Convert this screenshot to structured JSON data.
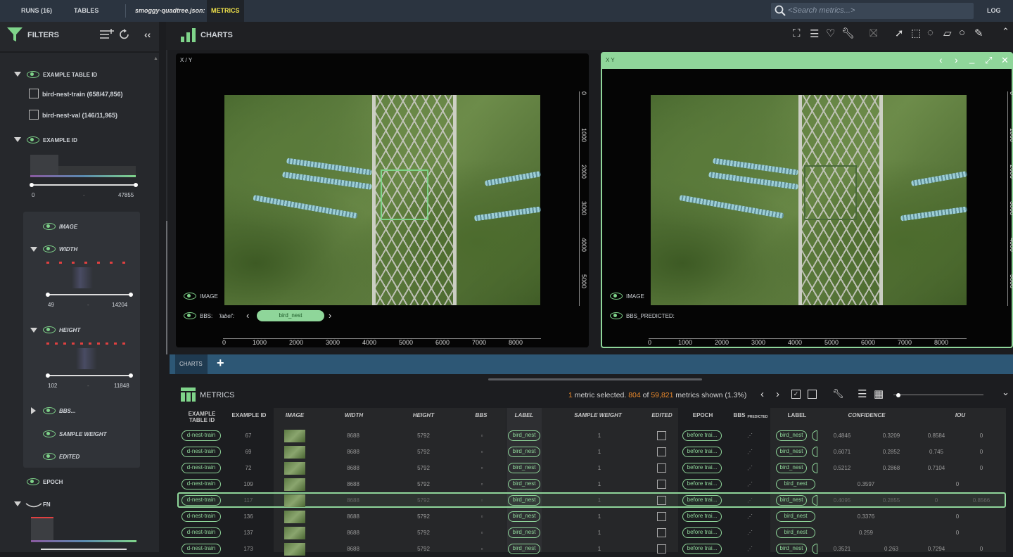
{
  "topbar": {
    "runs": "RUNS (16)",
    "tables": "TABLES",
    "file": "smoggy-quadtree.json:",
    "metrics": "METRICS",
    "search_placeholder": "<Search metrics...>",
    "log": "LOG"
  },
  "filters": {
    "title": "FILTERS",
    "example_table_id": "EXAMPLE TABLE ID",
    "table_items": [
      "bird-nest-train (658/47,856)",
      "bird-nest-val (146/11,965)"
    ],
    "example_id": "EXAMPLE ID",
    "example_id_min": "0",
    "example_id_sep": "-",
    "example_id_max": "47855",
    "image": "IMAGE",
    "width": "WIDTH",
    "width_min": "49",
    "width_max": "14204",
    "height": "HEIGHT",
    "height_min": "102",
    "height_max": "11848",
    "bbs": "BBS...",
    "sample_weight": "SAMPLE WEIGHT",
    "edited": "EDITED",
    "epoch": "EPOCH",
    "fn": "FN"
  },
  "charts": {
    "title": "CHARTS",
    "panel1": {
      "header": "X / Y",
      "image_label": "IMAGE",
      "bbs_label": "BBS:",
      "bbs_key": "'label':",
      "bbs_value": "bird_nest"
    },
    "panel2": {
      "header": "X   Y",
      "image_label": "IMAGE",
      "bbs_label": "BBS_PREDICTED:"
    },
    "xticks": [
      "0",
      "1000",
      "2000",
      "3000",
      "4000",
      "5000",
      "6000",
      "7000",
      "8000"
    ],
    "yticks": [
      "0",
      "1000",
      "2000",
      "3000",
      "4000",
      "5000"
    ]
  },
  "tabs": {
    "charts": "CHARTS",
    "add": "+"
  },
  "metrics": {
    "title": "METRICS",
    "selected_count": "1",
    "selected_text": " metric selected. ",
    "shown_count": "804",
    "of_text": " of ",
    "total": "59,821",
    "shown_text": " metrics shown (1.3%)"
  },
  "columns": [
    "EXAMPLE TABLE ID",
    "EXAMPLE ID",
    "IMAGE",
    "WIDTH",
    "HEIGHT",
    "BBS",
    "LABEL",
    "SAMPLE WEIGHT",
    "EDITED",
    "EPOCH",
    "BBS",
    "PREDICTED",
    "LABEL",
    "CONFIDENCE",
    "IOU"
  ],
  "rows": [
    {
      "table": "d-nest-train",
      "id": "67",
      "width": "8688",
      "height": "5792",
      "label": "bird_nest",
      "weight": "1",
      "epoch": "before trai...",
      "plabel": "bird_nest",
      "c1": "0.4846",
      "c2": "0.3209",
      "c3": "0.8584",
      "iou": "0"
    },
    {
      "table": "d-nest-train",
      "id": "69",
      "width": "8688",
      "height": "5792",
      "label": "bird_nest",
      "weight": "1",
      "epoch": "before trai...",
      "plabel": "bird_nest",
      "c1": "0.6071",
      "c2": "0.2852",
      "c3": "0.745",
      "iou": "0"
    },
    {
      "table": "d-nest-train",
      "id": "72",
      "width": "8688",
      "height": "5792",
      "label": "bird_nest",
      "weight": "1",
      "epoch": "before trai...",
      "plabel": "bird_nest",
      "c1": "0.5212",
      "c2": "0.2868",
      "c3": "0.7104",
      "iou": "0"
    },
    {
      "table": "d-nest-train",
      "id": "109",
      "width": "8688",
      "height": "5792",
      "label": "bird_nest",
      "weight": "1",
      "epoch": "before trai...",
      "plabel": "bird_nest",
      "c1": "",
      "c2": "0.3597",
      "c3": "",
      "iou": "0"
    },
    {
      "table": "d-nest-train",
      "id": "117",
      "width": "8688",
      "height": "5792",
      "label": "bird_nest",
      "weight": "1",
      "epoch": "before trai...",
      "plabel": "bird_nest",
      "c1": "0.4095",
      "c2": "0.2855",
      "c3": "0",
      "iou": "0.8566"
    },
    {
      "table": "d-nest-train",
      "id": "136",
      "width": "8688",
      "height": "5792",
      "label": "bird_nest",
      "weight": "1",
      "epoch": "before trai...",
      "plabel": "bird_nest",
      "c1": "",
      "c2": "0.3376",
      "c3": "",
      "iou": "0"
    },
    {
      "table": "d-nest-train",
      "id": "137",
      "width": "8688",
      "height": "5792",
      "label": "bird_nest",
      "weight": "1",
      "epoch": "before trai...",
      "plabel": "bird_nest",
      "c1": "",
      "c2": "0.259",
      "c3": "",
      "iou": "0"
    },
    {
      "table": "d-nest-train",
      "id": "173",
      "width": "8688",
      "height": "5792",
      "label": "bird_nest",
      "weight": "1",
      "epoch": "before trai...",
      "plabel": "bird_nest",
      "c1": "0.3521",
      "c2": "0.263",
      "c3": "0.7294",
      "iou": "0"
    }
  ],
  "colors": {
    "accent_green": "#8fd69a",
    "orange": "#e8872a",
    "yellow": "#f1e24a",
    "tab_blue": "#2d5775"
  }
}
